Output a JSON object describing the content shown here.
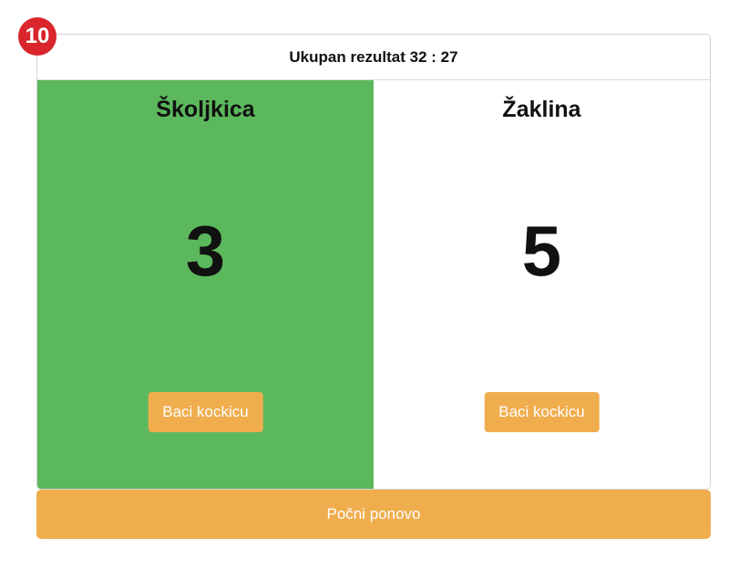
{
  "round_badge": "10",
  "score": {
    "label": "Ukupan rezultat 32 : 27"
  },
  "players": [
    {
      "name": "Školjkica",
      "roll": "3",
      "button_label": "Baci kockicu",
      "active": true
    },
    {
      "name": "Žaklina",
      "roll": "5",
      "button_label": "Baci kockicu",
      "active": false
    }
  ],
  "restart_label": "Počni ponovo",
  "colors": {
    "active_player": "#5cb85c",
    "button": "#f0ad4e",
    "badge": "#d9252b"
  }
}
